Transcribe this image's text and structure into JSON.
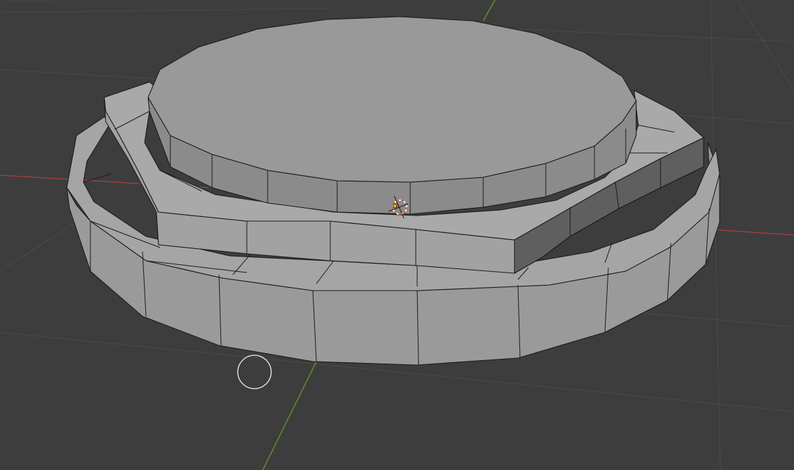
{
  "scene": {
    "object": "stepped-cylinder-mesh",
    "shading": "solid",
    "colors": {
      "background": "#3d3d3d",
      "grid": "#4a4a4a",
      "x_axis": "#a8413f",
      "y_axis": "#5d8a2e",
      "mesh_light": "#9c9c9c",
      "mesh_mid": "#8a8a8a",
      "mesh_dark": "#5e5e5e",
      "wire": "#1b1b1b",
      "cursor_red": "#e05a3a",
      "cursor_white": "#ffffff"
    },
    "icons": {
      "origin": "object-origin-icon",
      "cursor_3d": "3d-cursor-icon",
      "brush": "brush-circle-icon"
    }
  }
}
